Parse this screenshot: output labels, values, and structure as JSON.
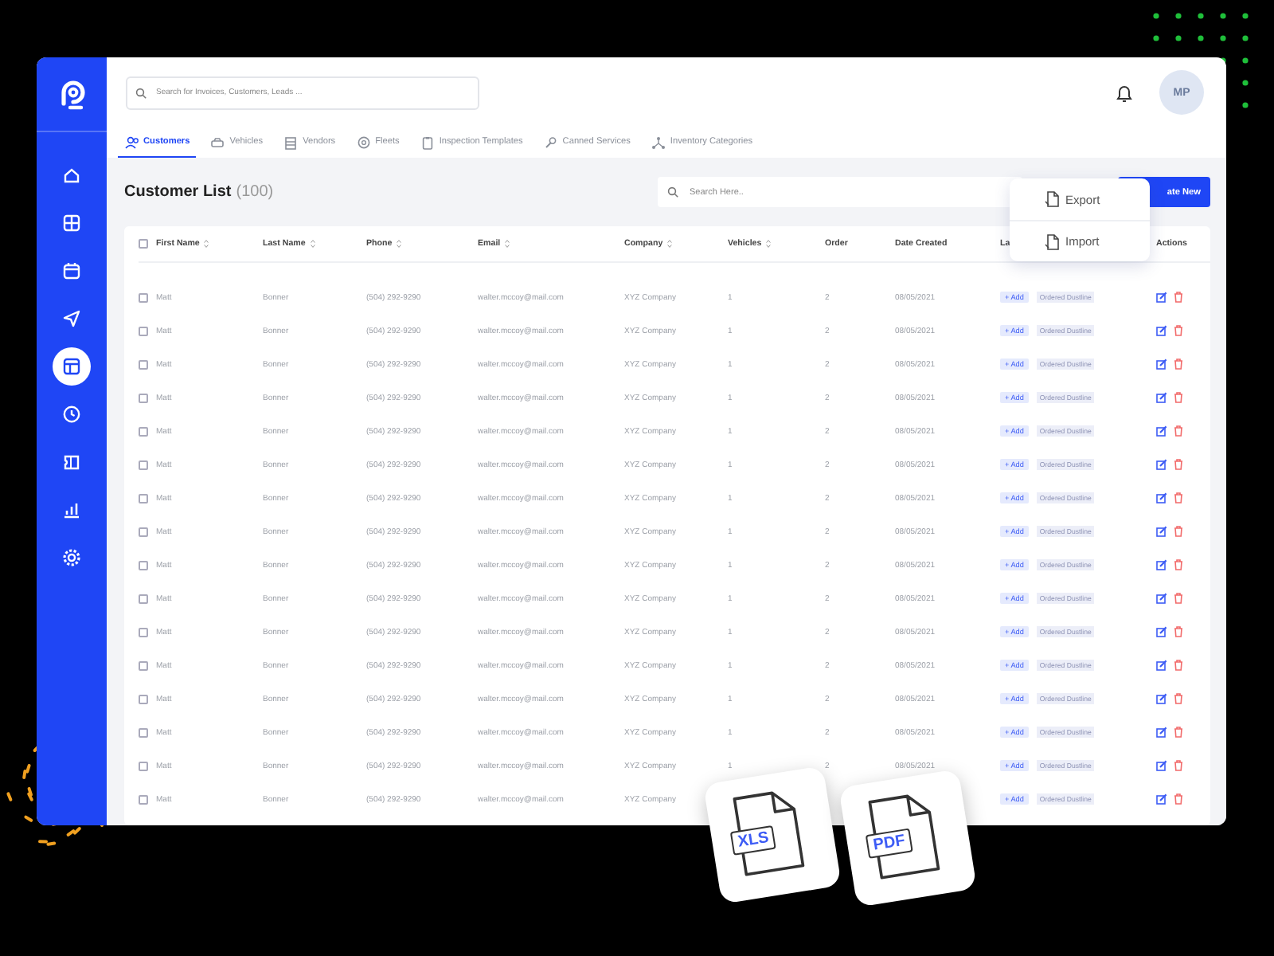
{
  "sidebar": {
    "items": [
      {
        "kind": "home",
        "selected": false
      },
      {
        "kind": "grid",
        "selected": false
      },
      {
        "kind": "calendar",
        "selected": false
      },
      {
        "kind": "send",
        "selected": false
      },
      {
        "kind": "table",
        "selected": true
      },
      {
        "kind": "clock",
        "selected": false
      },
      {
        "kind": "ticket",
        "selected": false
      },
      {
        "kind": "chart",
        "selected": false
      },
      {
        "kind": "gear",
        "selected": false
      }
    ]
  },
  "search": {
    "placeholder": "Search for Invoices, Customers, Leads ..."
  },
  "user": {
    "initials": "MP"
  },
  "tabs": [
    {
      "label": "Customers",
      "kind": "people",
      "selected": true
    },
    {
      "label": "Vehicles",
      "kind": "car",
      "selected": false
    },
    {
      "label": "Vendors",
      "kind": "store",
      "selected": false
    },
    {
      "label": "Fleets",
      "kind": "wheel",
      "selected": false
    },
    {
      "label": "Inspection Templates",
      "kind": "clipboard",
      "selected": false
    },
    {
      "label": "Canned Services",
      "kind": "wrench",
      "selected": false
    },
    {
      "label": "Inventory Categories",
      "kind": "branch",
      "selected": false
    }
  ],
  "page": {
    "title": "Customer List",
    "count": "(100)",
    "search_placeholder": "Search Here..",
    "create_button": "ate New"
  },
  "menu": {
    "items": [
      {
        "label": "Export"
      },
      {
        "label": "Import"
      }
    ]
  },
  "table": {
    "all_checked": false,
    "columns": [
      {
        "label": "First Name",
        "sortable": true
      },
      {
        "label": "Last Name",
        "sortable": true
      },
      {
        "label": "Phone",
        "sortable": true
      },
      {
        "label": "Email",
        "sortable": true
      },
      {
        "label": "Company",
        "sortable": true
      },
      {
        "label": "Vehicles",
        "sortable": true
      },
      {
        "label": "Order",
        "sortable": false
      },
      {
        "label": "Date Created",
        "sortable": false
      },
      {
        "label": "La",
        "sortable": false
      },
      {
        "label": "Actions",
        "sortable": false
      }
    ],
    "rows": [
      {
        "checked": false,
        "cells": [
          "Matt",
          "Bonner",
          "(504) 292-9290",
          "walter.mccoy@mail.com",
          "XYZ Company",
          "1",
          "2",
          "08/05/2021"
        ],
        "add": "+ Add",
        "tag": "Ordered Dustline"
      },
      {
        "checked": false,
        "cells": [
          "Matt",
          "Bonner",
          "(504) 292-9290",
          "walter.mccoy@mail.com",
          "XYZ Company",
          "1",
          "2",
          "08/05/2021"
        ],
        "add": "+ Add",
        "tag": "Ordered Dustline"
      },
      {
        "checked": false,
        "cells": [
          "Matt",
          "Bonner",
          "(504) 292-9290",
          "walter.mccoy@mail.com",
          "XYZ Company",
          "1",
          "2",
          "08/05/2021"
        ],
        "add": "+ Add",
        "tag": "Ordered Dustline"
      },
      {
        "checked": false,
        "cells": [
          "Matt",
          "Bonner",
          "(504) 292-9290",
          "walter.mccoy@mail.com",
          "XYZ Company",
          "1",
          "2",
          "08/05/2021"
        ],
        "add": "+ Add",
        "tag": "Ordered Dustline"
      },
      {
        "checked": false,
        "cells": [
          "Matt",
          "Bonner",
          "(504) 292-9290",
          "walter.mccoy@mail.com",
          "XYZ Company",
          "1",
          "2",
          "08/05/2021"
        ],
        "add": "+ Add",
        "tag": "Ordered Dustline"
      },
      {
        "checked": false,
        "cells": [
          "Matt",
          "Bonner",
          "(504) 292-9290",
          "walter.mccoy@mail.com",
          "XYZ Company",
          "1",
          "2",
          "08/05/2021"
        ],
        "add": "+ Add",
        "tag": "Ordered Dustline"
      },
      {
        "checked": false,
        "cells": [
          "Matt",
          "Bonner",
          "(504) 292-9290",
          "walter.mccoy@mail.com",
          "XYZ Company",
          "1",
          "2",
          "08/05/2021"
        ],
        "add": "+ Add",
        "tag": "Ordered Dustline"
      },
      {
        "checked": false,
        "cells": [
          "Matt",
          "Bonner",
          "(504) 292-9290",
          "walter.mccoy@mail.com",
          "XYZ Company",
          "1",
          "2",
          "08/05/2021"
        ],
        "add": "+ Add",
        "tag": "Ordered Dustline"
      },
      {
        "checked": false,
        "cells": [
          "Matt",
          "Bonner",
          "(504) 292-9290",
          "walter.mccoy@mail.com",
          "XYZ Company",
          "1",
          "2",
          "08/05/2021"
        ],
        "add": "+ Add",
        "tag": "Ordered Dustline"
      },
      {
        "checked": false,
        "cells": [
          "Matt",
          "Bonner",
          "(504) 292-9290",
          "walter.mccoy@mail.com",
          "XYZ Company",
          "1",
          "2",
          "08/05/2021"
        ],
        "add": "+ Add",
        "tag": "Ordered Dustline"
      },
      {
        "checked": false,
        "cells": [
          "Matt",
          "Bonner",
          "(504) 292-9290",
          "walter.mccoy@mail.com",
          "XYZ Company",
          "1",
          "2",
          "08/05/2021"
        ],
        "add": "+ Add",
        "tag": "Ordered Dustline"
      },
      {
        "checked": false,
        "cells": [
          "Matt",
          "Bonner",
          "(504) 292-9290",
          "walter.mccoy@mail.com",
          "XYZ Company",
          "1",
          "2",
          "08/05/2021"
        ],
        "add": "+ Add",
        "tag": "Ordered Dustline"
      },
      {
        "checked": false,
        "cells": [
          "Matt",
          "Bonner",
          "(504) 292-9290",
          "walter.mccoy@mail.com",
          "XYZ Company",
          "1",
          "2",
          "08/05/2021"
        ],
        "add": "+ Add",
        "tag": "Ordered Dustline"
      },
      {
        "checked": false,
        "cells": [
          "Matt",
          "Bonner",
          "(504) 292-9290",
          "walter.mccoy@mail.com",
          "XYZ Company",
          "1",
          "2",
          "08/05/2021"
        ],
        "add": "+ Add",
        "tag": "Ordered Dustline"
      },
      {
        "checked": false,
        "cells": [
          "Matt",
          "Bonner",
          "(504) 292-9290",
          "walter.mccoy@mail.com",
          "XYZ Company",
          "1",
          "2",
          "08/05/2021"
        ],
        "add": "+ Add",
        "tag": "Ordered Dustline"
      },
      {
        "checked": false,
        "cells": [
          "Matt",
          "Bonner",
          "(504) 292-9290",
          "walter.mccoy@mail.com",
          "XYZ Company"
        ],
        "add": "+ Add",
        "tag": "Ordered Dustline"
      }
    ]
  },
  "file_cards": [
    {
      "label": "XLS"
    },
    {
      "label": "PDF"
    }
  ]
}
